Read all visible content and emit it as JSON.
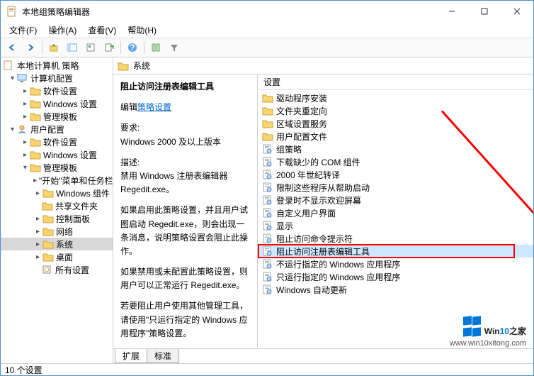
{
  "window": {
    "title": "本地组策略编辑器"
  },
  "menu": {
    "file": "文件(F)",
    "action": "操作(A)",
    "view": "查看(V)",
    "help": "帮助(H)"
  },
  "tree": {
    "root": "本地计算机 策略",
    "computer": "计算机配置",
    "c_soft": "软件设置",
    "c_win": "Windows 设置",
    "c_admin": "管理模板",
    "user": "用户配置",
    "u_soft": "软件设置",
    "u_win": "Windows 设置",
    "u_admin": "管理模板",
    "start": "\"开始\"菜单和任务栏",
    "wincomp": "Windows 组件",
    "share": "共享文件夹",
    "cpanel": "控制面板",
    "network": "网络",
    "system": "系统",
    "desktop": "桌面",
    "allset": "所有设置"
  },
  "header": {
    "title": "系统"
  },
  "desc": {
    "title": "阻止访问注册表编辑工具",
    "editlabel": "编辑",
    "editlink": "策略设置",
    "reqlabel": "要求:",
    "req": "Windows 2000 及以上版本",
    "desclabel": "描述:",
    "p1": "禁用 Windows 注册表编辑器 Regedit.exe。",
    "p2": "如果启用此策略设置，并且用户试图启动 Regedit.exe，则会出现一条消息，说明策略设置会阻止此操作。",
    "p3": "如果禁用或未配置此策略设置，则用户可以正常运行 Regedit.exe。",
    "p4": "若要阻止用户使用其他管理工具，请使用\"只运行指定的 Windows 应用程序\"策略设置。"
  },
  "list": {
    "head": "设置",
    "items": [
      "驱动程序安装",
      "文件夹重定向",
      "区域设置服务",
      "用户配置文件",
      "组策略",
      "下载缺少的 COM 组件",
      "2000 年世纪转译",
      "限制这些程序从帮助启动",
      "登录时不显示欢迎屏幕",
      "自定义用户界面",
      "显示",
      "阻止访问命令提示符",
      "阻止访问注册表编辑工具",
      "不运行指定的 Windows 应用程序",
      "只运行指定的 Windows 应用程序",
      "Windows 自动更新"
    ],
    "selectedIndex": 12,
    "folderCount": 4
  },
  "tabs": {
    "ext": "扩展",
    "std": "标准"
  },
  "status": "10 个设置",
  "watermark": {
    "brand_a": "Win",
    "brand_b": "10",
    "brand_c": "之家",
    "url": "www.win10xitong.com"
  }
}
